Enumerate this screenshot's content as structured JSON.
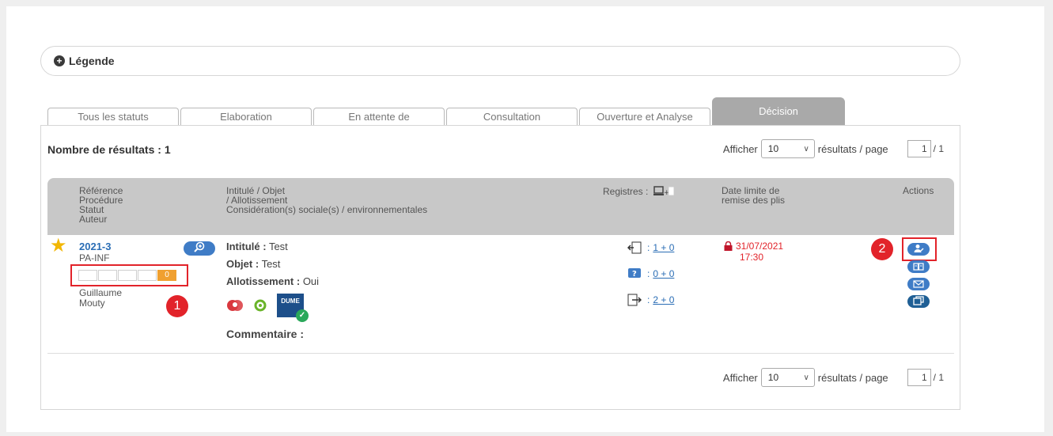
{
  "legend": {
    "label": "Légende",
    "icon": "plus-circle-icon"
  },
  "tabs": [
    {
      "label": "Tous les statuts",
      "active": false
    },
    {
      "label": "Elaboration",
      "active": false
    },
    {
      "label": "En attente de",
      "active": false
    },
    {
      "label": "Consultation",
      "active": false
    },
    {
      "label": "Ouverture et Analyse",
      "active": false
    },
    {
      "label": "Décision",
      "active": true
    }
  ],
  "results": {
    "label": "Nombre de résultats : 1"
  },
  "pager": {
    "afficher": "Afficher",
    "per_page_value": "10",
    "per_page_suffix": "résultats / page",
    "current_page": "1",
    "total_pages": "/ 1"
  },
  "table_header": {
    "col1": [
      "Référence",
      "Procédure",
      "Statut",
      "Auteur"
    ],
    "col2": [
      "Intitulé  / Objet",
      "/ Allotissement",
      "Considération(s) sociale(s) / environnementales"
    ],
    "col3": "Registres :",
    "col4": [
      "Date limite de",
      "remise des plis"
    ],
    "col5": "Actions"
  },
  "row": {
    "reference": "2021-3",
    "procedure": "PA-INF",
    "status_cells": [
      "",
      "",
      "",
      "",
      "0"
    ],
    "author_first": "Guillaume",
    "author_last": "Mouty",
    "intitule_label": "Intitulé :",
    "intitule_value": "Test",
    "objet_label": "Objet :",
    "objet_value": "Test",
    "allot_label": "Allotissement :",
    "allot_value": "Oui",
    "dume_label": "DUME",
    "comment_label": "Commentaire :",
    "registres": [
      {
        "icon": "download-register-icon",
        "value": "1 + 0"
      },
      {
        "icon": "question-register-icon",
        "value": "0 + 0"
      },
      {
        "icon": "deposit-register-icon",
        "value": "2 + 0"
      }
    ],
    "deadline_date": "31/07/2021",
    "deadline_time": "17:30"
  },
  "badges": [
    "1",
    "2"
  ],
  "colors": {
    "link": "#2a6db5",
    "accent": "#e2232a",
    "tab_active": "#a9a9a9",
    "button": "#3f7cc6"
  }
}
